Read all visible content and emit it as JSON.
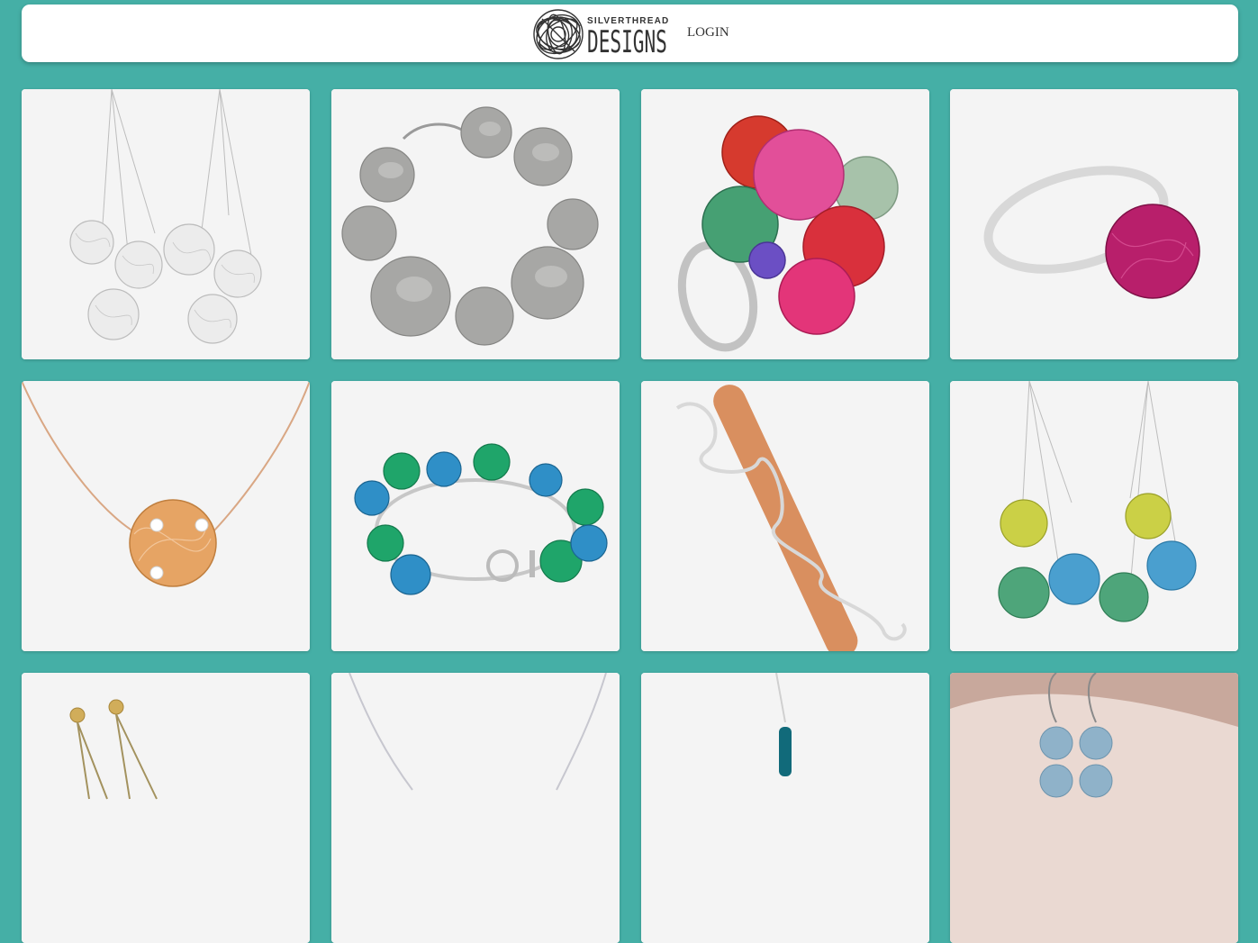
{
  "header": {
    "brand_top": "SILVERTHREAD",
    "brand_bottom": "DESIGNS",
    "login_label": "LOGIN"
  },
  "gallery": {
    "items": [
      {
        "subject": "silver-wire-ball-drop-earrings",
        "colors": [
          "#d8d8d8"
        ]
      },
      {
        "subject": "hammered-silver-disc-bracelet",
        "colors": [
          "#9c9c9a"
        ]
      },
      {
        "subject": "multicolor-wire-ball-cluster-ring",
        "colors": [
          "#d8302e",
          "#e0438f",
          "#3c8f66",
          "#9ab9a3",
          "#6b4fc4"
        ]
      },
      {
        "subject": "magenta-wire-ball-silver-ring",
        "colors": [
          "#b81f6b"
        ]
      },
      {
        "subject": "copper-wire-ball-pearl-necklace",
        "colors": [
          "#e39a5c"
        ]
      },
      {
        "subject": "blue-green-wire-ball-charm-bracelet",
        "colors": [
          "#2f8fc7",
          "#1fa56a"
        ]
      },
      {
        "subject": "copper-silver-wrapped-pendant",
        "colors": [
          "#d98f5f"
        ]
      },
      {
        "subject": "yellow-green-blue-wire-ball-earrings",
        "colors": [
          "#c9cf3c",
          "#4caa9a",
          "#3f9fcf"
        ]
      },
      {
        "subject": "gold-post-chain-earrings",
        "colors": [
          "#c9a34f"
        ]
      },
      {
        "subject": "silver-chain-necklace",
        "colors": [
          "#bdbdc4"
        ]
      },
      {
        "subject": "teal-wire-pendant-necklace",
        "colors": [
          "#116a7a"
        ]
      },
      {
        "subject": "aquamarine-bead-drop-earrings",
        "colors": [
          "#8fb2c9"
        ]
      }
    ]
  }
}
